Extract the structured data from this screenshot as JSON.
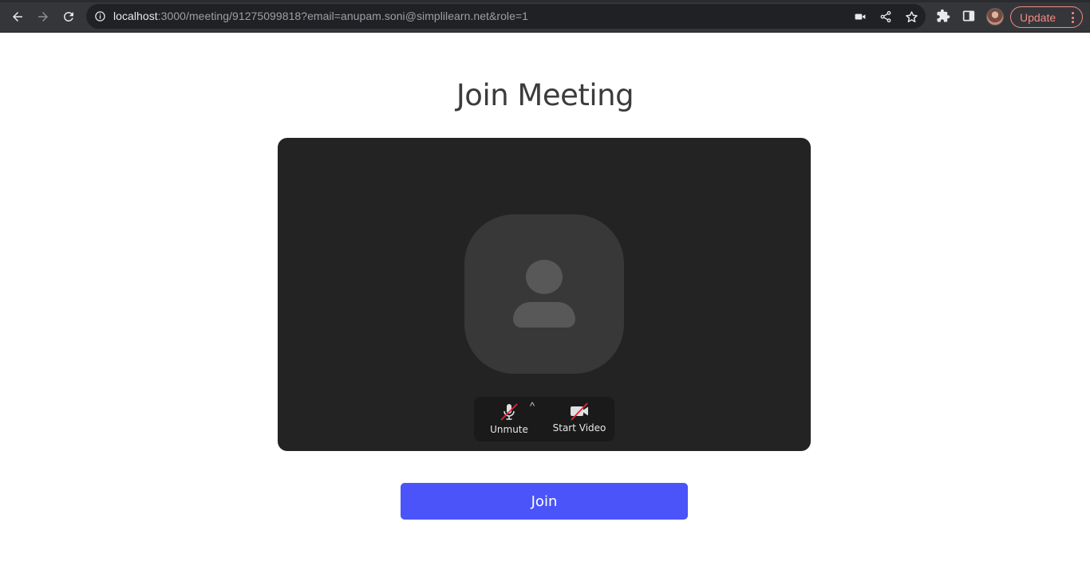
{
  "browser": {
    "url_host": "localhost",
    "url_rest": ":3000/meeting/91275099818?email=anupam.soni@simplilearn.net&role=1",
    "update_label": "Update"
  },
  "page": {
    "title": "Join Meeting"
  },
  "preview": {
    "mute_label": "Unmute",
    "video_label": "Start Video",
    "caret": "^"
  },
  "join": {
    "label": "Join"
  },
  "colors": {
    "join_button": "#4a54f8",
    "preview_bg": "#232323",
    "update_accent": "#f28b82"
  }
}
